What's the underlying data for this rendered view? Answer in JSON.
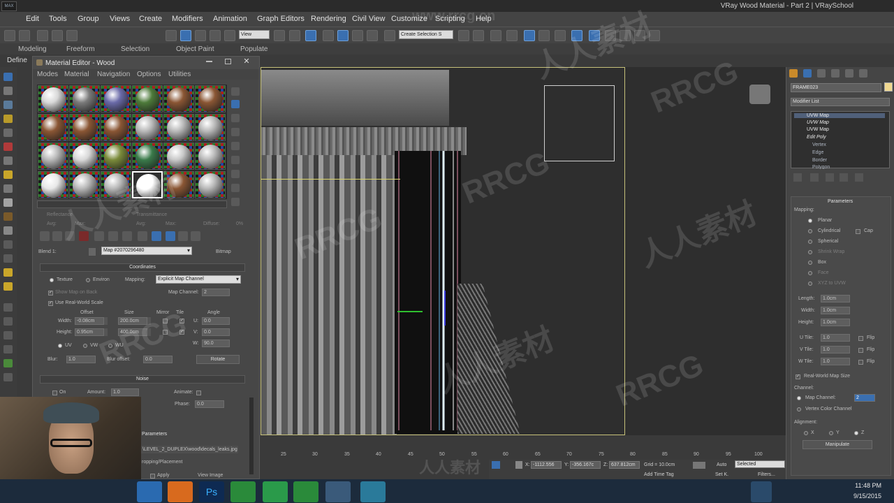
{
  "window": {
    "title": "VRay Wood Material - Part 2 | VRaySchool",
    "logo": "MAX"
  },
  "menu": [
    "Edit",
    "Tools",
    "Group",
    "Views",
    "Create",
    "Modifiers",
    "Animation",
    "Graph Editors",
    "Rendering",
    "Civil View",
    "Customize",
    "Scripting",
    "Help"
  ],
  "toolbar": {
    "view_combo": "View",
    "selection_set": "Create Selection S"
  },
  "ribbon": [
    "Modeling",
    "Freeform",
    "Selection",
    "Object Paint",
    "Populate"
  ],
  "define_label": "Define",
  "material_editor": {
    "title": "Material Editor - Wood",
    "menu": [
      "Modes",
      "Material",
      "Navigation",
      "Options",
      "Utilities"
    ],
    "slot_colors": [
      "#d8d8d8",
      "#7a7a7a",
      "#6a6aa8",
      "#4d7a3a",
      "#8a5634",
      "#8a5634",
      "#8a5634",
      "#8a5634",
      "#8a5634",
      "#b8b8b8",
      "#b8b8b8",
      "#b8b8b8",
      "#b8b8b8",
      "#d8d8d8",
      "#7a8a3a",
      "#3a7a4a",
      "#c8c8c8",
      "#b8b8b8",
      "#e8e8e8",
      "#b8b8b8",
      "#b8b8b8",
      "#ffffff",
      "#8a5634",
      "#b8b8b8"
    ],
    "selected_slot": 21,
    "labels": {
      "reflectance": "Reflectance",
      "transmittance": "Transmittance",
      "avg": "Avg:",
      "max": "Max:",
      "diffuse": "Diffuse:",
      "diffuse_val": "0%",
      "blend": "Blend 1:",
      "map_name": "Map #2070296480",
      "map_type": "Bitmap"
    },
    "coordinates": {
      "header": "Coordinates",
      "texture": "Texture",
      "environ": "Environ",
      "mapping_label": "Mapping:",
      "mapping": "Explicit Map Channel",
      "show_map": "Show Map on Back",
      "map_channel_label": "Map Channel:",
      "map_channel": "2",
      "real_world": "Use Real-World Scale",
      "offset": "Offset",
      "size": "Size",
      "mirror": "Mirror",
      "tile": "Tile",
      "angle": "Angle",
      "width": "Width:",
      "height": "Height:",
      "width_offset": "-0.08cm",
      "height_offset": "0.95cm",
      "width_size": "200.0cm",
      "height_size": "400.0cm",
      "u_label": "U:",
      "v_label": "V:",
      "w_label": "W:",
      "u_angle": "0.0",
      "v_angle": "0.0",
      "w_angle": "90.0",
      "uv": "UV",
      "vw": "VW",
      "wu": "WU",
      "blur": "Blur:",
      "blur_val": "1.0",
      "blur_offset": "Blur offset:",
      "blur_offset_val": "0.0",
      "rotate": "Rotate"
    },
    "noise": {
      "header": "Noise",
      "on": "On",
      "amount": "Amount:",
      "amount_val": "1.0",
      "animate": "Animate:",
      "phase": "Phase:",
      "phase_val": "0.0"
    },
    "bitmap": {
      "header": "Parameters",
      "path": "\\LEVEL_2_DUPLEX\\wood\\decals_leaks.jpg",
      "cropping": "ropping/Placement",
      "apply": "Apply",
      "view_image": "View Image"
    }
  },
  "viewport": {
    "ruler_ticks": [
      "25",
      "30",
      "35",
      "40",
      "45",
      "50",
      "55",
      "60",
      "65",
      "70",
      "75",
      "80",
      "85",
      "90",
      "95",
      "100"
    ]
  },
  "command_panel": {
    "object_name": "FRAME023",
    "modifier_list": "Modifier List",
    "stack": [
      {
        "label": "UVW Map",
        "type": "mod"
      },
      {
        "label": "UVW Map",
        "type": "mod"
      },
      {
        "label": "UVW Map",
        "type": "mod"
      },
      {
        "label": "Edit Poly",
        "type": "mod"
      },
      {
        "label": "Vertex",
        "type": "sub"
      },
      {
        "label": "Edge",
        "type": "sub"
      },
      {
        "label": "Border",
        "type": "sub"
      },
      {
        "label": "Polygon",
        "type": "sub"
      }
    ],
    "params": {
      "header": "Parameters",
      "mapping": "Mapping:",
      "planar": "Planar",
      "cylindrical": "Cylindrical",
      "cap": "Cap",
      "spherical": "Spherical",
      "shrink": "Shrink Wrap",
      "box": "Box",
      "face": "Face",
      "xyz": "XYZ to UVW",
      "length": "Length:",
      "width": "Width:",
      "height": "Height:",
      "len_val": "1.0cm",
      "wid_val": "1.0cm",
      "hei_val": "1.0cm",
      "u_tile": "U Tile:",
      "v_tile": "V Tile:",
      "w_tile": "W Tile:",
      "tile_val": "1.0",
      "flip": "Flip",
      "real_world": "Real-World Map Size",
      "channel": "Channel:",
      "map_channel": "Map Channel:",
      "map_channel_val": "2",
      "vertex_color": "Vertex Color Channel",
      "alignment": "Alignment:",
      "x": "X",
      "y": "Y",
      "z": "Z",
      "manipulate": "Manipulate"
    }
  },
  "status": {
    "x_label": "X:",
    "x_val": "-1112.556",
    "y_label": "Y:",
    "y_val": "-356.167c",
    "z_label": "Z:",
    "z_val": "637.812cm",
    "grid": "Grid = 10.0cm",
    "add_time_tag": "Add Time Tag",
    "auto": "Auto",
    "set_key": "Set K.",
    "selected": "Selected",
    "filters": "Filters...",
    "frame": "0"
  },
  "taskbar": {
    "time": "11:48 PM",
    "date": "9/15/2015"
  },
  "watermarks": [
    "RRCG",
    "人人素材",
    "www.rrcg.cn"
  ]
}
